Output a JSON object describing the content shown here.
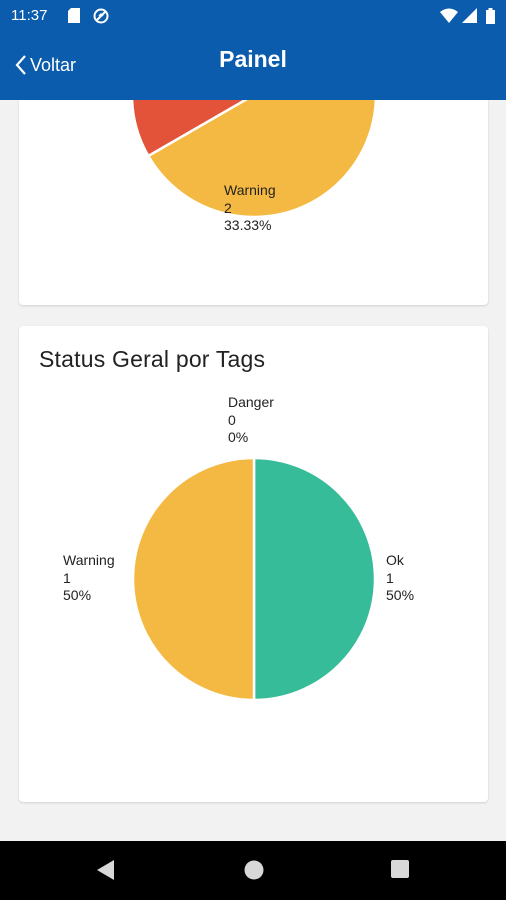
{
  "status_bar": {
    "time": "11:37",
    "icons": [
      "sd-card-icon",
      "data-saver-icon",
      "wifi-icon",
      "signal-icon",
      "battery-icon"
    ]
  },
  "app_bar": {
    "back_label": "Voltar",
    "title": "Painel",
    "color": "#0b5cad"
  },
  "colors": {
    "danger": "#e2533a",
    "warning": "#f4b942",
    "ok": "#36bc98"
  },
  "cards": [
    {
      "title": "",
      "labels": [
        {
          "name": "Warning",
          "count": "2",
          "percent": "33.33%"
        }
      ],
      "chart_data": {
        "type": "pie",
        "title": "",
        "slices": [
          {
            "name": "Warning",
            "value": 2,
            "percent": 33.33
          }
        ]
      }
    },
    {
      "title": "Status Geral por Tags",
      "labels": [
        {
          "name": "Danger",
          "count": "0",
          "percent": "0%"
        },
        {
          "name": "Warning",
          "count": "1",
          "percent": "50%"
        },
        {
          "name": "Ok",
          "count": "1",
          "percent": "50%"
        }
      ],
      "chart_data": {
        "type": "pie",
        "title": "Status Geral por Tags",
        "slices": [
          {
            "name": "Danger",
            "value": 0,
            "percent": 0
          },
          {
            "name": "Warning",
            "value": 1,
            "percent": 50
          },
          {
            "name": "Ok",
            "value": 1,
            "percent": 50
          }
        ]
      }
    }
  ],
  "nav_bar": {
    "buttons": [
      "back-nav-icon",
      "home-nav-icon",
      "recents-nav-icon"
    ]
  }
}
